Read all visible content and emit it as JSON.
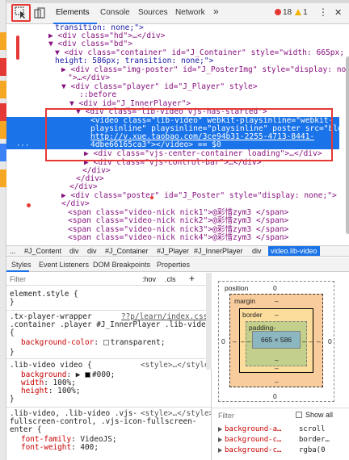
{
  "toolbar": {
    "tabs": [
      "Elements",
      "Console",
      "Sources",
      "Network"
    ],
    "more": "»",
    "error_count": "18",
    "warning_count": "1",
    "menu_icon": "⋮",
    "close_icon": "✕"
  },
  "dom_lines": [
    "transition: none;\">",
    "▶ <div class=\"hd\">…</div>",
    "▼ <div class=\"bd\">",
    "▼ <div class=\"container\" id=\"J_Container\" style=\"width: 665px;",
    "height: 586px; transition: none;\">",
    "▶ <div class=\"img-poster\" id=\"J_PosterImg\" style=\"display: none;",
    "\">…</div>",
    "▼ <div class=\"player\" id=\"J_Player\" style>",
    "::before",
    "▼ <div id=\"J_InnerPlayer\">",
    "▼ <div class=\"lib-video vjs-has-started\">",
    "<video class=\"lib-video\" webkit-playsinline=\"webkit-",
    "playsinline\" playsinline=\"playsinline\" poster src=\"blob:",
    "http://v.xue.taobao.com/3ce94b31-2255-4713-8441-",
    "4dbe66165ca3\"></video> == $0",
    "▶ <div class=\"vjs-center-container loading\">…</div>",
    "▶ <div class=\"vjs-control-bar\">…</div>",
    "</div>",
    "</div>",
    "</div>",
    "▶ <div class=\"poster\" id=\"J_Poster\" style=\"display: none;\">",
    "</div>",
    "<span class=\"video-nick nick1\">@彩惜zym3 </span>",
    "<span class=\"video-nick nick2\">@彩惜zym3 </span>",
    "<span class=\"video-nick nick3\">@彩惜zym3 </span>",
    "<span class=\"video-nick nick4\">@彩惜zym3 </span>"
  ],
  "breadcrumb": [
    "...",
    "#J_Content",
    "div",
    "div",
    "#J_Container",
    "#J_Player",
    "#J_InnerPlayer",
    "div",
    "video.lib-video"
  ],
  "panel_tabs": [
    "Styles",
    "Event Listeners",
    "DOM Breakpoints",
    "Properties"
  ],
  "styles": {
    "filter_placeholder": "Filter",
    "hov": ":hov",
    "cls": ".cls",
    "plus": "+",
    "element_style": "element.style {",
    "close_brace": "}",
    "rule1_selector_a": ".tx-player-wrapper",
    "rule1_source": "??p/learn/index.css:1",
    "rule1_selector_b": ".container .player #J_InnerPlayer .lib-video",
    "open_brace": "{",
    "rule1_prop": "background-color",
    "rule1_val": "transparent;",
    "rule2_selector": ".lib-video video {",
    "rule2_source": "<style>…</style>",
    "rule2_props": [
      {
        "name": "background",
        "value": "#000;"
      },
      {
        "name": "width",
        "value": "100%;"
      },
      {
        "name": "height",
        "value": "100%;"
      }
    ],
    "rule3_selector_a": ".lib-video, .lib-video .vjs-",
    "rule3_source": "<style>…</style>",
    "rule3_selector_b": "fullscreen-control, .vjs-icon-fullscreen-",
    "rule3_selector_c": "enter {",
    "rule3_props": [
      {
        "name": "font-family",
        "value": "VideoJS;"
      },
      {
        "name": "font-weight",
        "value": "400;"
      }
    ]
  },
  "box_model": {
    "position_label": "position",
    "position_value": "0",
    "margin_label": "margin",
    "border_label": "border",
    "padding_label": "padding-",
    "dash": "–",
    "zero": "0",
    "content": "665 × 586"
  },
  "computed": {
    "filter_placeholder": "Filter",
    "show_all": "Show all",
    "rows": [
      {
        "name": "background-a…",
        "value": "scroll"
      },
      {
        "name": "background-c…",
        "value": "border…"
      },
      {
        "name": "background-c…",
        "value": "rgba(0"
      }
    ]
  },
  "colors": {
    "accent": "#1a73e8",
    "highlight_red": "#e53935",
    "tag": "#881280",
    "attr": "#994500",
    "value": "#1a1aa6",
    "swatch_black": "#000000"
  }
}
